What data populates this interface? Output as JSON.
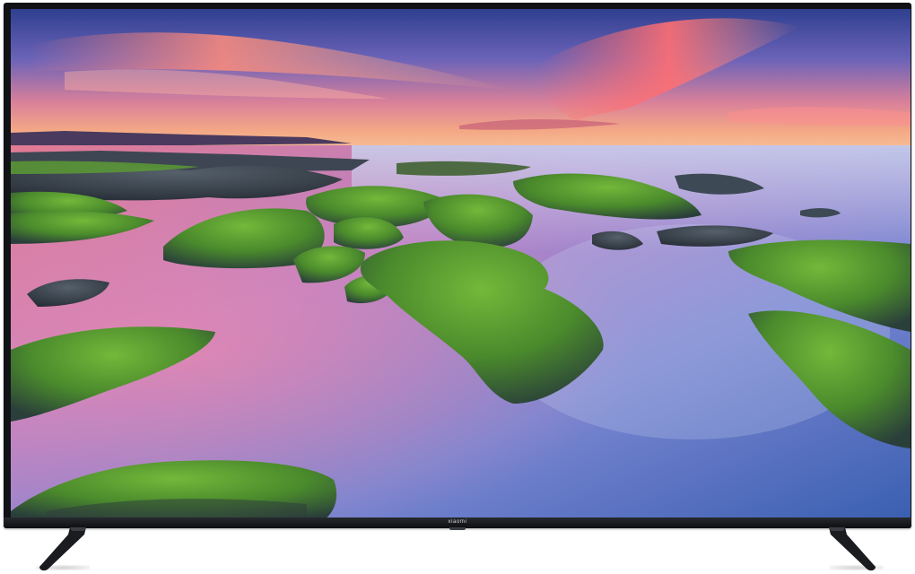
{
  "product": {
    "brand_logo": "xiaomi",
    "frame_color": "#101215"
  },
  "screen_scene": {
    "subject": "seaside-rocks-with-moss-at-sunset",
    "sky_colors": [
      "#3b4aa0",
      "#e27a8e",
      "#f5a67a"
    ],
    "water_colors": [
      "#e07a96",
      "#8a7fd0",
      "#3e64b4"
    ],
    "moss_color": "#4f9a2e"
  }
}
